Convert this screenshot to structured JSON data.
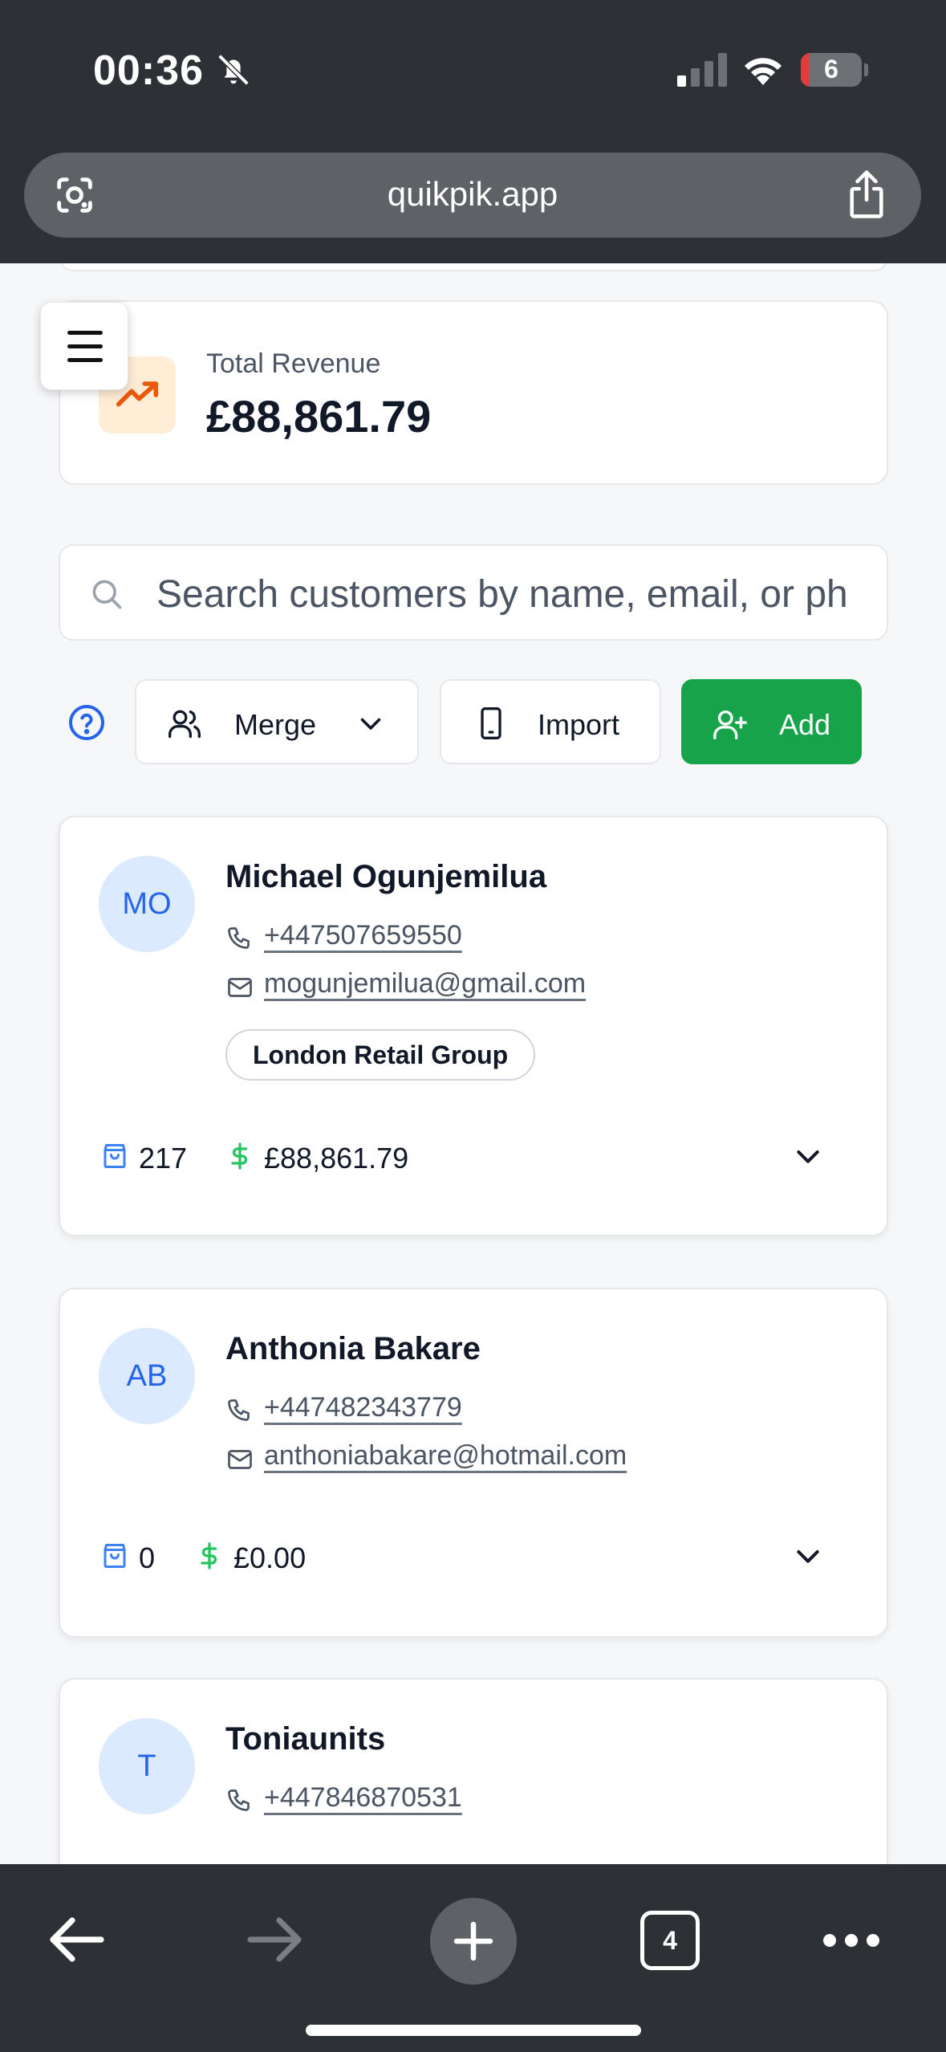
{
  "status_bar": {
    "time": "00:36",
    "battery": "6"
  },
  "browser": {
    "url": "quikpik.app",
    "tab_count": "4"
  },
  "revenue": {
    "label": "Total Revenue",
    "value": "£88,861.79"
  },
  "search": {
    "placeholder": "Search customers by name, email, or ph"
  },
  "toolbar": {
    "merge_label": "Merge",
    "import_label": "Import",
    "add_label": "Add"
  },
  "colors": {
    "accent_green": "#16a34a",
    "avatar_bg": "#dbeafe",
    "avatar_text": "#2563eb",
    "dollar_green": "#22c55e",
    "bag_blue": "#3b82f6",
    "revenue_icon": "#ea580c"
  },
  "customers": [
    {
      "initials": "MO",
      "name": "Michael Ogunjemilua",
      "phone": "+447507659550",
      "email": "mogunjemilua@gmail.com",
      "tag": "London Retail Group",
      "orders": "217",
      "spent": "£88,861.79"
    },
    {
      "initials": "AB",
      "name": "Anthonia Bakare",
      "phone": "+447482343779",
      "email": "anthoniabakare@hotmail.com",
      "orders": "0",
      "spent": "£0.00"
    },
    {
      "initials": "T",
      "name": "Toniaunits",
      "phone": "+447846870531"
    }
  ]
}
